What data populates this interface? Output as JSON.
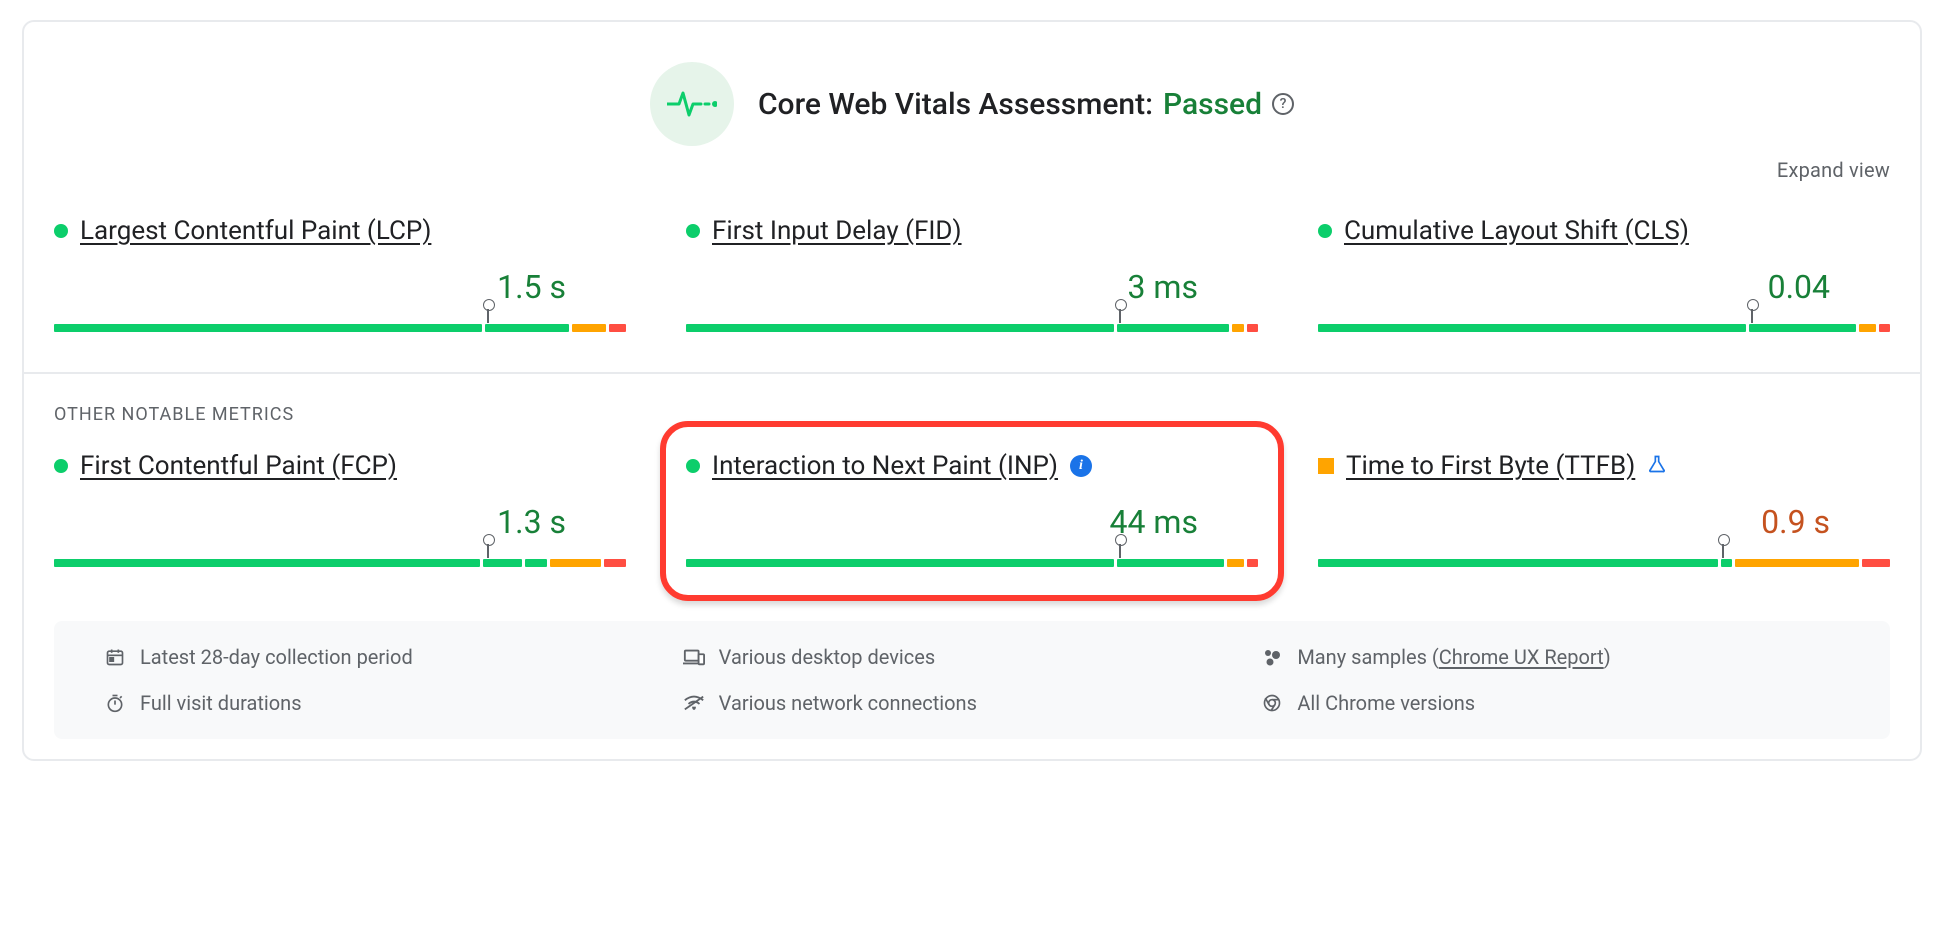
{
  "header": {
    "title_prefix": "Core Web Vitals Assessment: ",
    "status": "Passed"
  },
  "expand_view": "Expand view",
  "core_metrics": [
    {
      "name": "Largest Contentful Paint (LCP)",
      "value": "1.5 s",
      "status": "green",
      "marker_pct": 76,
      "segs": [
        76,
        15,
        6,
        3
      ],
      "seg_colors": [
        "green",
        "green",
        "orange",
        "red"
      ]
    },
    {
      "name": "First Input Delay (FID)",
      "value": "3 ms",
      "status": "green",
      "marker_pct": 76,
      "segs": [
        76,
        20,
        2,
        2
      ],
      "seg_colors": [
        "green",
        "green",
        "orange",
        "red"
      ]
    },
    {
      "name": "Cumulative Layout Shift (CLS)",
      "value": "0.04",
      "status": "green",
      "marker_pct": 76,
      "segs": [
        76,
        19,
        3,
        2
      ],
      "seg_colors": [
        "green",
        "green",
        "orange",
        "red"
      ]
    }
  ],
  "other_section_label": "OTHER NOTABLE METRICS",
  "other_metrics": [
    {
      "name": "First Contentful Paint (FCP)",
      "value": "1.3 s",
      "status": "green",
      "marker_pct": 76,
      "segs": [
        76,
        7,
        4,
        9,
        4
      ],
      "seg_colors": [
        "green",
        "green",
        "green",
        "orange",
        "red"
      ],
      "badge": null,
      "highlighted": false
    },
    {
      "name": "Interaction to Next Paint (INP)",
      "value": "44 ms",
      "status": "green",
      "marker_pct": 76,
      "segs": [
        76,
        19,
        3,
        2
      ],
      "seg_colors": [
        "green",
        "green",
        "orange",
        "red"
      ],
      "badge": "info",
      "highlighted": true
    },
    {
      "name": "Time to First Byte (TTFB)",
      "value": "0.9 s",
      "status": "orange",
      "marker_pct": 71,
      "segs": [
        71,
        2,
        22,
        5
      ],
      "seg_colors": [
        "green",
        "green",
        "orange",
        "red"
      ],
      "badge": "flask",
      "highlighted": false
    }
  ],
  "footer": {
    "period": "Latest 28-day collection period",
    "devices": "Various desktop devices",
    "samples_prefix": "Many samples (",
    "samples_link": "Chrome UX Report",
    "samples_suffix": ")",
    "durations": "Full visit durations",
    "network": "Various network connections",
    "chrome": "All Chrome versions"
  }
}
